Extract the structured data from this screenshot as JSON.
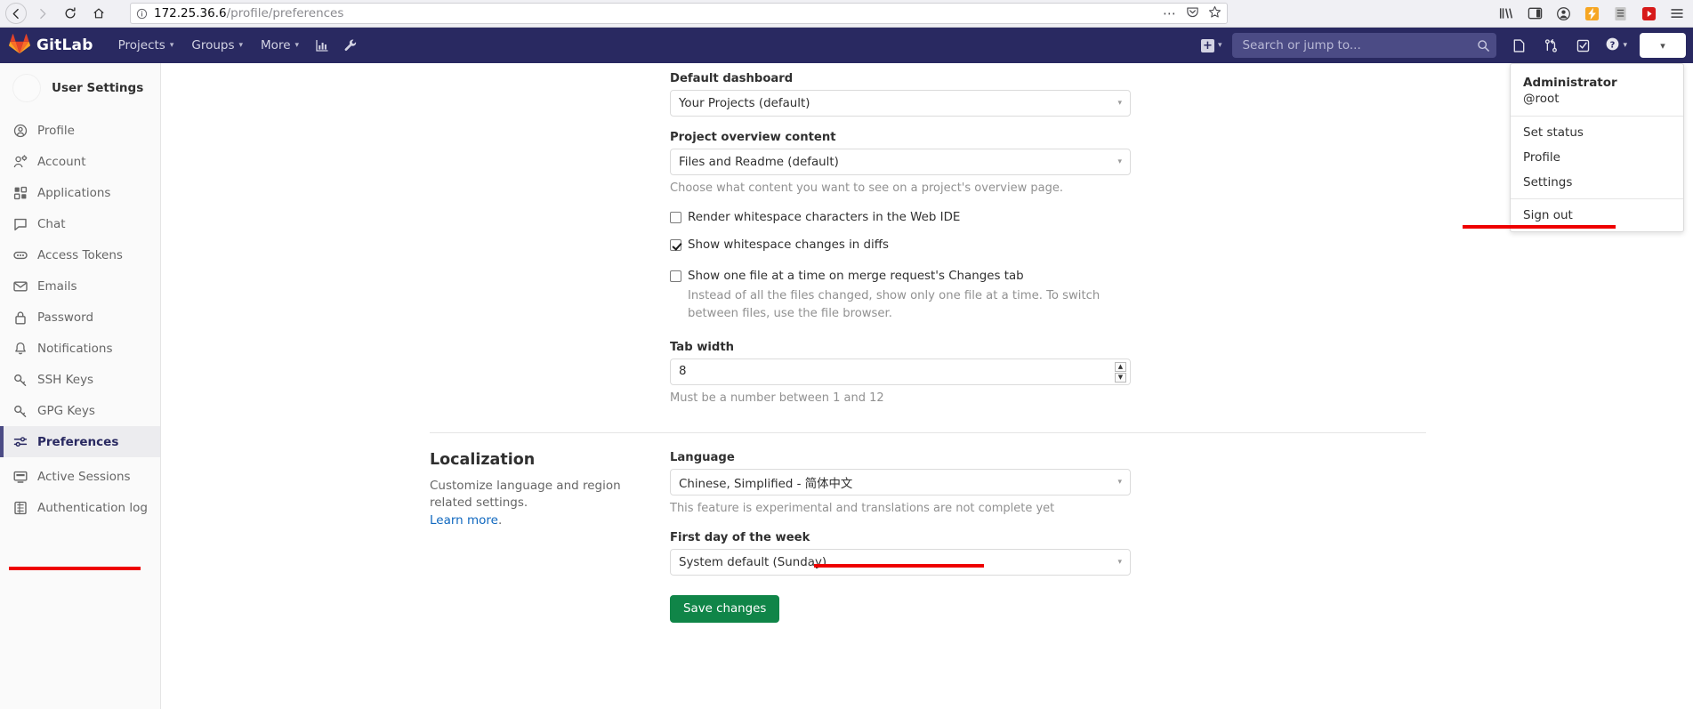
{
  "browser": {
    "back_icon": "back-arrow-icon",
    "forward_icon": "forward-arrow-icon",
    "reload_icon": "reload-icon",
    "home_icon": "home-icon",
    "url_host": "172.25.36.6",
    "url_path": "/profile/preferences",
    "url_full": "172.25.36.6/profile/preferences",
    "info_icon": "page-info-icon",
    "more_icon": "ellipsis-icon",
    "pocket_icon": "pocket-icon",
    "bookmark_icon": "star-icon",
    "toolbar_icons": [
      "library-icon",
      "sidebar-icon",
      "account-icon",
      "extension-icon",
      "container-tabs-icon",
      "youtube-icon",
      "hamburger-menu-icon"
    ]
  },
  "navbar": {
    "brand": "GitLab",
    "brand_icon": "gitlab-tanuki-icon",
    "items": [
      {
        "label": "Projects",
        "caret": "⌄"
      },
      {
        "label": "Groups",
        "caret": "⌄"
      },
      {
        "label": "More",
        "caret": "⌄"
      }
    ],
    "icon_items": [
      {
        "name": "analytics-icon"
      },
      {
        "name": "wrench-icon"
      }
    ],
    "new_label": "+",
    "new_caret": "⌄",
    "search": {
      "placeholder": "Search or jump to...",
      "value": "",
      "icon": "search-icon"
    },
    "right_icons": [
      {
        "name": "issues-icon"
      },
      {
        "name": "merge-requests-icon"
      },
      {
        "name": "todos-icon"
      }
    ],
    "help_icon": "help-circle-icon",
    "help_caret": "⌄",
    "avatar_caret": "⌄",
    "bg_color": "#292961"
  },
  "user_dropdown": {
    "name": "Administrator",
    "handle": "@root",
    "items_group_1": [
      "Set status",
      "Profile",
      "Settings"
    ],
    "items_group_2": [
      "Sign out"
    ]
  },
  "sidebar": {
    "title": "User Settings",
    "avatar": "user-avatar",
    "items": [
      {
        "label": "Profile",
        "icon": "profile-icon",
        "active": false
      },
      {
        "label": "Account",
        "icon": "account-icon",
        "active": false
      },
      {
        "label": "Applications",
        "icon": "applications-grid-icon",
        "active": false
      },
      {
        "label": "Chat",
        "icon": "chat-bubble-icon",
        "active": false
      },
      {
        "label": "Access Tokens",
        "icon": "token-icon",
        "active": false
      },
      {
        "label": "Emails",
        "icon": "envelope-icon",
        "active": false
      },
      {
        "label": "Password",
        "icon": "lock-icon",
        "active": false
      },
      {
        "label": "Notifications",
        "icon": "bell-icon",
        "active": false
      },
      {
        "label": "SSH Keys",
        "icon": "key-icon",
        "active": false
      },
      {
        "label": "GPG Keys",
        "icon": "key-icon",
        "active": false
      },
      {
        "label": "Preferences",
        "icon": "sliders-icon",
        "active": true
      },
      {
        "label": "Active Sessions",
        "icon": "monitor-icon",
        "active": false
      },
      {
        "label": "Authentication log",
        "icon": "log-grid-icon",
        "active": false
      }
    ]
  },
  "behavior": {
    "default_dashboard_label": "Default dashboard",
    "default_dashboard_value": "Your Projects (default)",
    "project_overview_label": "Project overview content",
    "project_overview_value": "Files and Readme (default)",
    "project_overview_help": "Choose what content you want to see on a project's overview page.",
    "checkbox_render_whitespace": "Render whitespace characters in the Web IDE",
    "checkbox_render_whitespace_checked": false,
    "checkbox_show_whitespace": "Show whitespace changes in diffs",
    "checkbox_show_whitespace_checked": true,
    "checkbox_one_file": "Show one file at a time on merge request's Changes tab",
    "checkbox_one_file_checked": false,
    "one_file_help": "Instead of all the files changed, show only one file at a time. To switch between files, use the file browser.",
    "tab_width_label": "Tab width",
    "tab_width_value": "8",
    "tab_width_help": "Must be a number between 1 and 12"
  },
  "localization": {
    "title": "Localization",
    "description": "Customize language and region related settings.",
    "learn_more": "Learn more",
    "learn_more_suffix": ".",
    "language_label": "Language",
    "language_value": "Chinese, Simplified - 简体中文",
    "language_help": "This feature is experimental and translations are not complete yet",
    "first_day_label": "First day of the week",
    "first_day_value": "System default (Sunday)",
    "save_label": "Save changes"
  },
  "annotations": {
    "color": "#ee0000",
    "count": 3,
    "targets": [
      "settings-menu-item",
      "preferences-sidebar-item",
      "language-select"
    ]
  }
}
